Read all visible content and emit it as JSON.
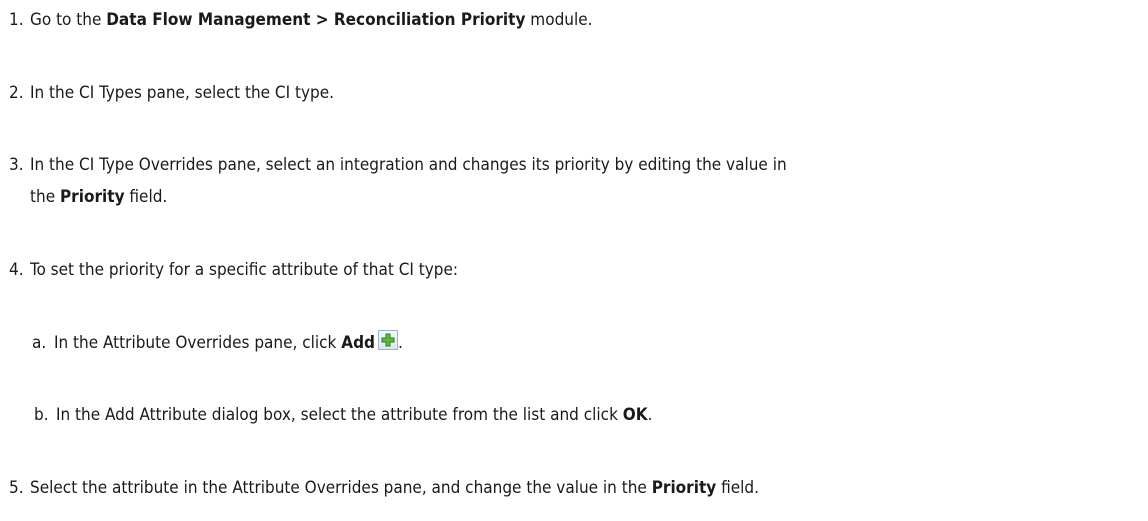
{
  "steps": [
    {
      "num": "1.",
      "pre": "Go to the ",
      "bold": "Data Flow Management > Reconciliation Priority",
      "post": " module."
    },
    {
      "num": "2.",
      "text": "In the CI Types pane, select the CI type."
    },
    {
      "num": "3.",
      "line1": "In the CI Type Overrides pane, select an integration and changes its priority by editing the value in",
      "pre2": "the ",
      "bold": "Priority",
      "post2": " field."
    },
    {
      "num": "4.",
      "text": "To set the priority for a specific attribute of that CI type:",
      "substeps": [
        {
          "num": "a.",
          "pre": "In the Attribute Overrides pane, click ",
          "bold": "Add",
          "icon": "add-plus-icon",
          "post": "."
        },
        {
          "num": "b.",
          "pre": "In the Add Attribute dialog box, select the attribute from the list and click ",
          "bold": "OK",
          "post": "."
        }
      ]
    },
    {
      "num": "5.",
      "pre": "Select the attribute in the Attribute Overrides pane, and change the value in the ",
      "bold": "Priority",
      "post": " field."
    }
  ]
}
